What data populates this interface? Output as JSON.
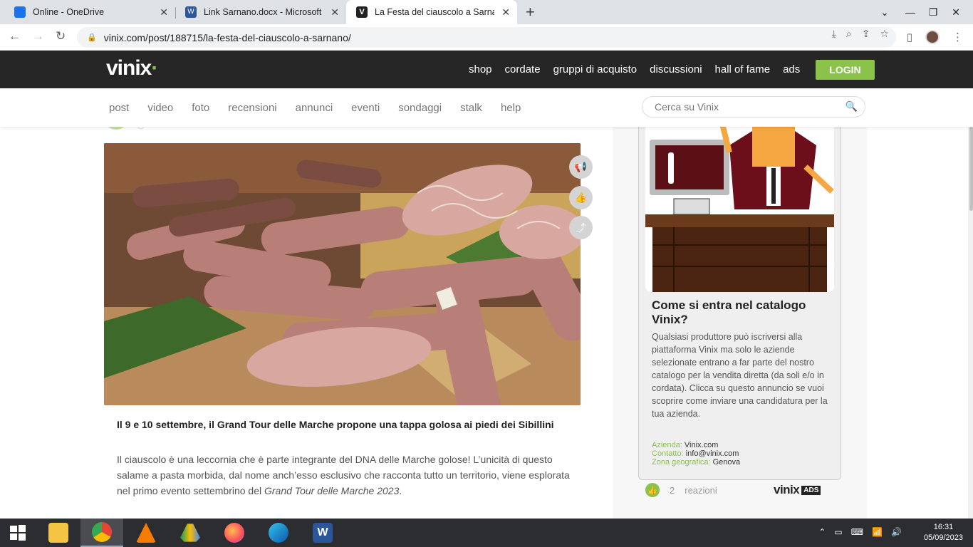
{
  "browser": {
    "tabs": [
      {
        "title": "Online - OneDrive",
        "icon": "onedrive-icon",
        "active": false
      },
      {
        "title": "Link Sarnano.docx - Microsoft Wo",
        "icon": "word-icon",
        "active": false
      },
      {
        "title": "La Festa del ciauscolo a Sarnano",
        "icon": "vinix-icon",
        "active": true
      }
    ],
    "url": "vinix.com/post/188715/la-festa-del-ciauscolo-a-sarnano/"
  },
  "site": {
    "logo": "vinix",
    "nav": [
      "shop",
      "cordate",
      "gruppi di acquisto",
      "discussioni",
      "hall of fame",
      "ads"
    ],
    "login_label": "LOGIN",
    "subnav": [
      "post",
      "video",
      "foto",
      "recensioni",
      "annunci",
      "eventi",
      "sondaggi",
      "stalk",
      "help"
    ],
    "search_placeholder": "Cerca su Vinix"
  },
  "article": {
    "subtitle": "Il 9 e 10 settembre, il Grand Tour delle Marche propone una tappa golosa ai piedi dei Sibillini",
    "body_start": "Il ciauscolo è una leccornia che è parte integrante del DNA delle Marche golose! L’unicità di questo salame a pasta morbida, dal nome anch’esso esclusivo che racconta tutto un territorio, viene esplorata nel primo evento settembrino del ",
    "body_italic": "Grand Tour delle Marche 2023",
    "body_end": "."
  },
  "ad": {
    "title": "Come si entra nel catalogo Vinix?",
    "text": "Qualsiasi produttore può iscriversi alla piattaforma Vinix ma solo le aziende selezionate entrano a far parte del nostro catalogo per la vendita diretta (da soli e/o in cordata). Clicca su questo annuncio se vuoi scoprire come inviare una candidatura per la tua azienda.",
    "meta": [
      {
        "key": "Azienda:",
        "value": "Vinix.com"
      },
      {
        "key": "Contatto:",
        "value": "info@vinix.com"
      },
      {
        "key": "Zona geografica:",
        "value": "Genova"
      }
    ],
    "reactions_count": "2",
    "reactions_label": "reazioni",
    "ads_brand": "vinix",
    "ads_badge": "ADS"
  },
  "taskbar": {
    "time": "16:31",
    "date": "05/09/2023"
  },
  "colors": {
    "accent": "#8bc34a",
    "header_bg": "#262626"
  }
}
